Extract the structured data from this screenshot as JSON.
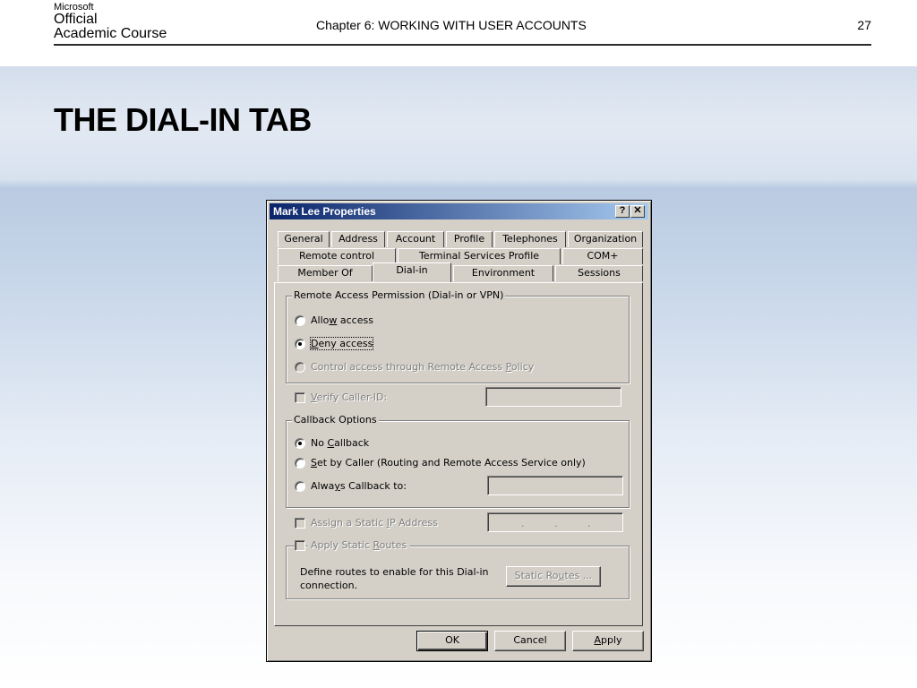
{
  "header": {
    "logo": {
      "line1": "Microsoft",
      "line2": "Official",
      "line3": "Academic Course"
    },
    "chapter": "Chapter 6: WORKING WITH USER ACCOUNTS",
    "page_number": "27"
  },
  "slide_title": "THE DIAL-IN TAB",
  "dialog": {
    "title": "Mark Lee Properties",
    "help_button": "?",
    "close_button": "✕",
    "tabs": {
      "row1": [
        "General",
        "Address",
        "Account",
        "Profile",
        "Telephones",
        "Organization"
      ],
      "row2": [
        "Remote control",
        "Terminal Services Profile",
        "COM+"
      ],
      "row3": [
        "Member Of",
        "Dial-in",
        "Environment",
        "Sessions"
      ]
    },
    "active_tab": "Dial-in",
    "remote_access": {
      "legend": "Remote Access Permission (Dial-in or VPN)",
      "allow_pre": "Allo",
      "allow_key": "w",
      "allow_post": " access",
      "deny_key": "D",
      "deny_post": "eny access",
      "control_pre": "Control access through Remote Access ",
      "control_key": "P",
      "control_post": "olicy",
      "selected": "Deny access"
    },
    "verify_caller": {
      "key": "V",
      "rest": "erify Caller-ID:",
      "value": ""
    },
    "callback": {
      "legend": "Callback Options",
      "no_pre": "No ",
      "no_key": "C",
      "no_post": "allback",
      "set_key": "S",
      "set_post": "et by Caller (Routing and Remote Access Service only)",
      "always_pre": "Alwa",
      "always_key": "y",
      "always_post": "s Callback to:",
      "selected": "No Callback",
      "number_value": ""
    },
    "static_ip": {
      "pre": "Assign a Static ",
      "key": "I",
      "post": "P Address",
      "dots": [
        ".",
        ".",
        "."
      ]
    },
    "static_routes": {
      "pre": "Apply Static ",
      "key": "R",
      "post": "outes",
      "description_line1": "Define routes to enable for this Dial-in",
      "description_line2": "connection.",
      "btn_pre": "Static Ro",
      "btn_key": "u",
      "btn_post": "tes ..."
    },
    "buttons": {
      "ok": "OK",
      "cancel": "Cancel",
      "apply_key": "A",
      "apply_post": "pply"
    }
  }
}
